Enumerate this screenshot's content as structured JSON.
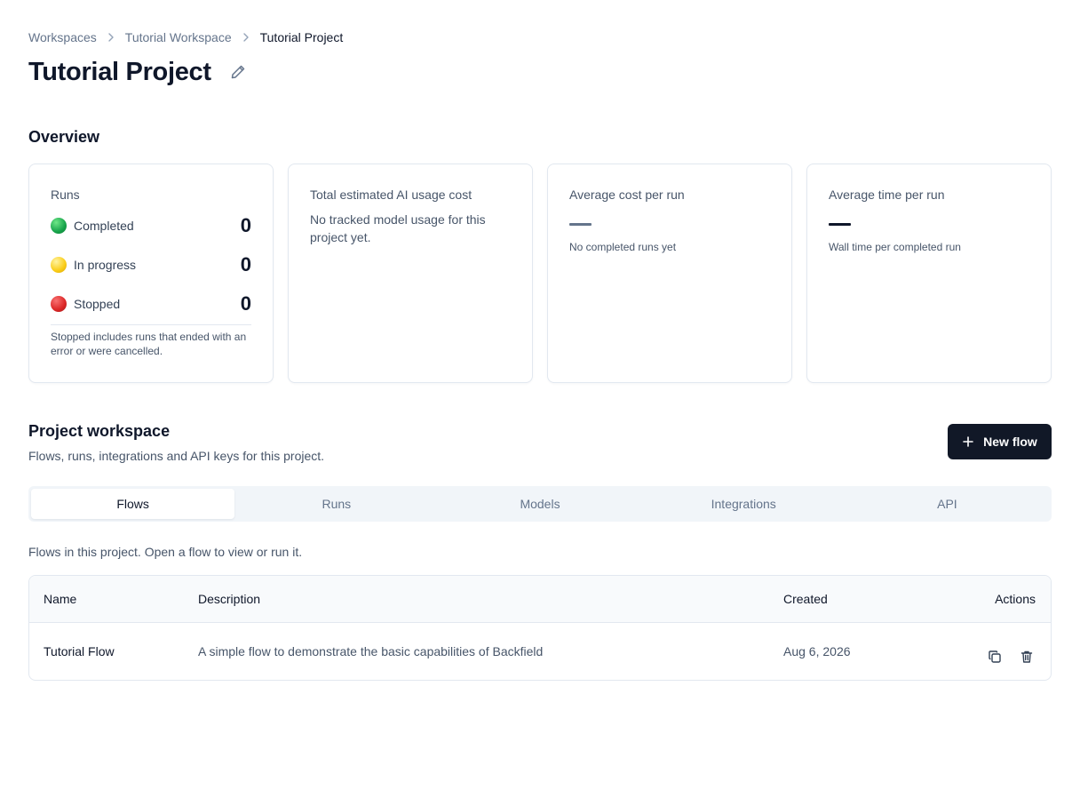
{
  "breadcrumb": [
    "Workspaces",
    "Tutorial Workspace",
    "Tutorial Project"
  ],
  "page_title": "Tutorial Project",
  "overview": {
    "heading": "Overview",
    "runs_card": {
      "title": "Runs",
      "rows": [
        {
          "label": "Completed",
          "count": "0",
          "color": "#16a34a"
        },
        {
          "label": "In progress",
          "count": "0",
          "color": "#facc15"
        },
        {
          "label": "Stopped",
          "count": "0",
          "color": "#dc2626"
        }
      ],
      "note": "Stopped includes runs that ended with an error or were cancelled."
    },
    "cost_card": {
      "title": "Total estimated AI usage cost",
      "text": "No tracked model usage for this project yet."
    },
    "avg_cost_card": {
      "title": "Average cost per run",
      "subtext": "No completed runs yet"
    },
    "avg_time_card": {
      "title": "Average time per run",
      "subtext": "Wall time per completed run"
    }
  },
  "workspace": {
    "heading": "Project workspace",
    "subheading": "Flows, runs, integrations and API keys for this project.",
    "new_flow_label": "New flow",
    "tabs": [
      "Flows",
      "Runs",
      "Models",
      "Integrations",
      "API"
    ],
    "active_tab": "Flows"
  },
  "flows": {
    "hint": "Flows in this project. Open a flow to view or run it.",
    "columns": [
      "Name",
      "Description",
      "Created",
      "Actions"
    ],
    "rows": [
      {
        "name": "Tutorial Flow",
        "description": "A simple flow to demonstrate the basic capabilities of Backfield",
        "created": "Aug 6, 2026",
        "actions": [
          "copy-icon",
          "trash-icon"
        ]
      }
    ]
  },
  "icons": {
    "breadcrumb_separator": "chevron-right-icon",
    "edit": "pencil-icon",
    "new_flow": "plus-icon"
  },
  "colors": {
    "primary_button": "#111827",
    "completed": "#16a34a",
    "in_progress": "#facc15",
    "stopped": "#dc2626"
  }
}
